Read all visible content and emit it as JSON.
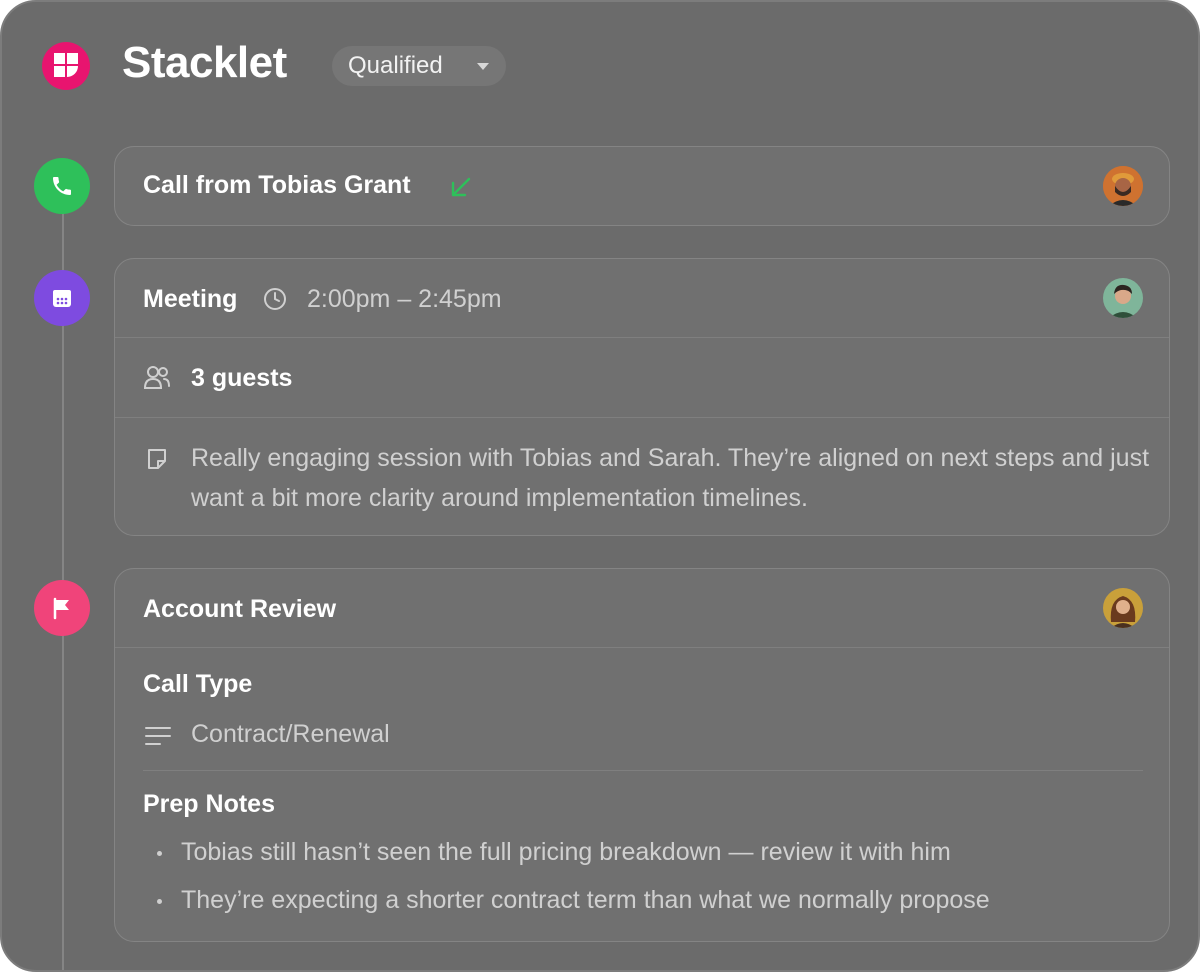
{
  "app": {
    "title": "Stacklet",
    "status": "Qualified"
  },
  "timeline": {
    "call": {
      "title": "Call from Tobias Grant",
      "direction": "incoming",
      "icon": "phone-icon",
      "color": "#2ec05a"
    },
    "meeting": {
      "title": "Meeting",
      "time": "2:00pm – 2:45pm",
      "guests": "3 guests",
      "note": "Really engaging session with Tobias and Sarah. They’re aligned on next steps and just want a bit more clarity around implementation timelines.",
      "icon": "calendar-icon",
      "color": "#7e4be0"
    },
    "review": {
      "title": "Account Review",
      "call_type_label": "Call Type",
      "call_type_value": "Contract/Renewal",
      "prep_notes_label": "Prep Notes",
      "prep_notes": [
        "Tobias still hasn’t seen the full pricing breakdown — review it with him",
        "They’re expecting a shorter contract term than what we normally propose"
      ],
      "icon": "flag-icon",
      "color": "#f0447a"
    }
  },
  "colors": {
    "brand": "#e8146f",
    "incoming_arrow": "#2ec05a"
  }
}
